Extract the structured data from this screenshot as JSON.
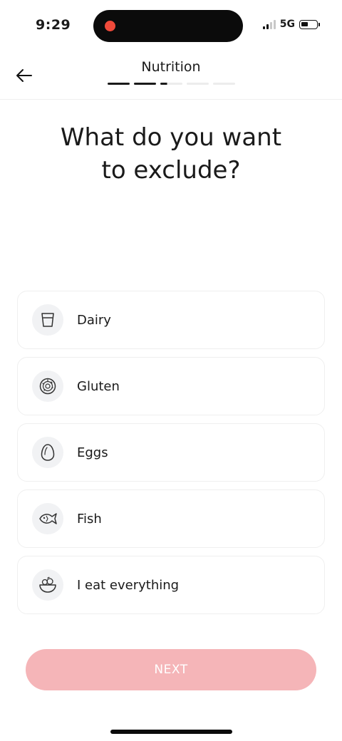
{
  "status_bar": {
    "time": "9:29",
    "network": "5G"
  },
  "header": {
    "title": "Nutrition",
    "progress": {
      "total_steps": 5,
      "completed_steps": 2,
      "current_step_fraction": 0.3
    }
  },
  "question": {
    "line1": "What do you want",
    "line2": "to exclude?"
  },
  "options": [
    {
      "label": "Dairy",
      "icon": "glass-icon"
    },
    {
      "label": "Gluten",
      "icon": "donut-icon"
    },
    {
      "label": "Eggs",
      "icon": "egg-icon"
    },
    {
      "label": "Fish",
      "icon": "fish-icon"
    },
    {
      "label": "I eat everything",
      "icon": "bowl-icon"
    }
  ],
  "next_button": {
    "label": "NEXT"
  },
  "colors": {
    "accent_disabled": "#f5b5b8",
    "recording": "#f04a3a",
    "text": "#1a1a1a"
  }
}
